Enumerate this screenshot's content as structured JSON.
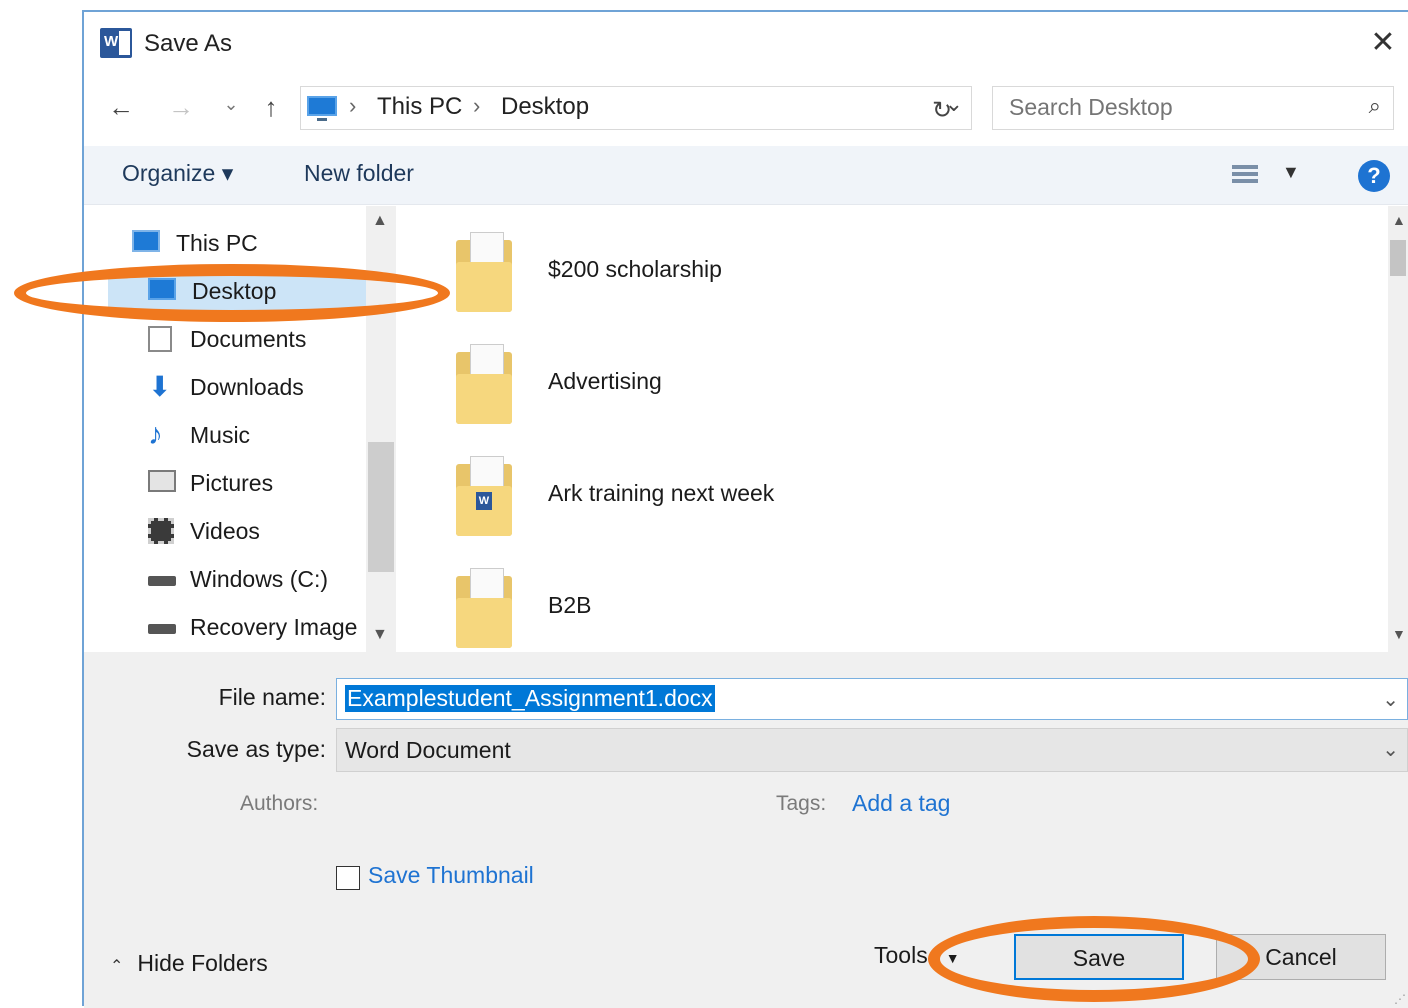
{
  "window": {
    "title": "Save As",
    "app_icon": "word-icon"
  },
  "nav": {
    "back_icon": "←",
    "forward_icon": "→",
    "recent_icon": "⌄",
    "up_icon": "↑",
    "breadcrumb": [
      "This PC",
      "Desktop"
    ],
    "refresh_icon": "↻",
    "search_placeholder": "Search Desktop",
    "search_icon": "⌕"
  },
  "toolbar": {
    "organize_label": "Organize ▾",
    "new_folder_label": "New folder",
    "help_label": "?"
  },
  "sidebar": {
    "items": [
      {
        "label": "This PC",
        "icon": "monitor-icon"
      },
      {
        "label": "Desktop",
        "icon": "desktop-icon",
        "selected": true
      },
      {
        "label": "Documents",
        "icon": "documents-icon"
      },
      {
        "label": "Downloads",
        "icon": "download-icon"
      },
      {
        "label": "Music",
        "icon": "music-icon"
      },
      {
        "label": "Pictures",
        "icon": "pictures-icon"
      },
      {
        "label": "Videos",
        "icon": "videos-icon"
      },
      {
        "label": "Windows (C:)",
        "icon": "drive-icon"
      },
      {
        "label": "Recovery Image",
        "icon": "drive-icon"
      }
    ]
  },
  "files": [
    {
      "name": "$200 scholarship",
      "icon": "folder-icon"
    },
    {
      "name": "Advertising",
      "icon": "folder-icon"
    },
    {
      "name": "Ark training next week",
      "icon": "folder-icon"
    },
    {
      "name": "B2B",
      "icon": "folder-icon"
    }
  ],
  "form": {
    "file_name_label": "File name:",
    "file_name_value": "Examplestudent_Assignment1.docx",
    "save_as_type_label": "Save as type:",
    "save_as_type_value": "Word Document",
    "authors_label": "Authors:",
    "tags_label": "Tags:",
    "add_tag_label": "Add a tag",
    "save_thumbnail_label": "Save Thumbnail",
    "save_thumbnail_checked": false
  },
  "footer": {
    "hide_folders_label": "Hide Folders",
    "tools_label": "Tools",
    "save_label": "Save",
    "cancel_label": "Cancel"
  },
  "colors": {
    "accent": "#0078d7",
    "annotation": "#f0781e",
    "selection": "#cce4f7",
    "link": "#1e73d2"
  }
}
